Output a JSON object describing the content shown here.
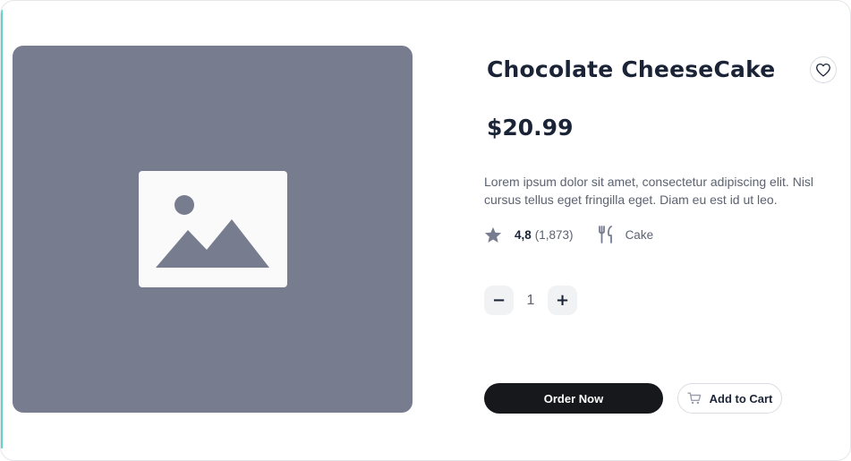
{
  "product": {
    "title": "Chocolate CheeseCake",
    "price": "$20.99",
    "description": "Lorem ipsum dolor sit amet, consectetur adipiscing elit. Nisl cursus tellus eget fringilla eget. Diam eu est id ut leo.",
    "rating": "4,8",
    "rating_count": "(1,873)",
    "category": "Cake",
    "image_icon": "image-placeholder-icon"
  },
  "quantity": {
    "decrement_label": "−",
    "value": "1",
    "increment_label": "+"
  },
  "actions": {
    "order_label": "Order Now",
    "cart_label": "Add to Cart",
    "favorite_icon": "heart-icon",
    "cart_icon": "cart-icon"
  },
  "icons": {
    "rating": "star-icon",
    "category": "fork-knife-icon"
  },
  "colors": {
    "image_bg": "#777d8f",
    "primary_dark": "#17181b",
    "title_text": "#1b2437",
    "accent_left_border": "#5fd3c8"
  }
}
